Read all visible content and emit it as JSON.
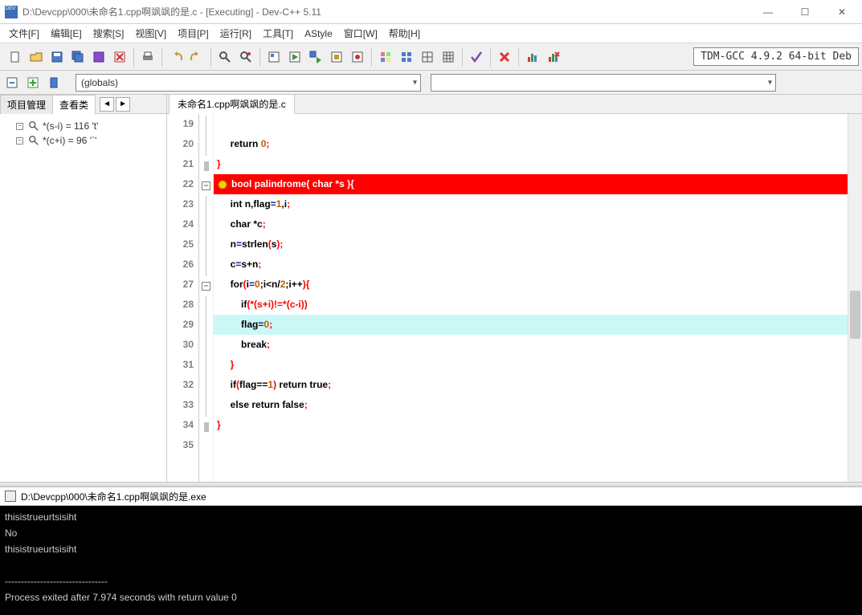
{
  "window": {
    "title": "D:\\Devcpp\\000\\未命名1.cpp啊飒飒的是.c - [Executing] - Dev-C++ 5.11",
    "min": "—",
    "max": "☐",
    "close": "✕"
  },
  "menu": {
    "items": [
      "文件[F]",
      "编辑[E]",
      "搜索[S]",
      "视图[V]",
      "项目[P]",
      "运行[R]",
      "工具[T]",
      "AStyle",
      "窗口[W]",
      "帮助[H]"
    ]
  },
  "compiler_label": "TDM-GCC 4.9.2 64-bit Deb",
  "globals_combo": "(globals)",
  "sidebar": {
    "tabs": [
      "项目管理",
      "查看类"
    ],
    "nav_left": "◄",
    "nav_right": "►",
    "items": [
      {
        "label": "*(s-i) = 116 't'"
      },
      {
        "label": "*(c+i) = 96 '`'"
      }
    ]
  },
  "editor": {
    "tab_label": "未命名1.cpp啊飒飒的是.c",
    "line_numbers": [
      "19",
      "20",
      "21",
      "22",
      "23",
      "24",
      "25",
      "26",
      "27",
      "28",
      "29",
      "30",
      "31",
      "32",
      "33",
      "34",
      "35"
    ],
    "lines": {
      "l20_return": "return",
      "l20_zero": "0",
      "l22_bool": "bool",
      "l22_name": "palindrome",
      "l22_char": "char",
      "l22_arg": "*s",
      "l23_int": "int",
      "l23_vars": "n,flag",
      "l23_one": "1",
      "l23_i": ",i",
      "l24_char": "char",
      "l24_c": "*c",
      "l25_assign": "n",
      "l25_eq": "=",
      "l25_fn": "strlen",
      "l25_arg": "s",
      "l26_lhs": "c",
      "l26_eq": "=",
      "l26_rhs": "s+n",
      "l27_for": "for",
      "l27_init": "i",
      "l27_eq": "=",
      "l27_z": "0",
      "l27_cond": ";i<n/",
      "l27_two": "2",
      "l27_upd": ";i++",
      "l28_if": "if",
      "l28_expr": "(*(s+i)!=*(c-i))",
      "l29_lhs": "flag",
      "l29_eq": "=",
      "l29_z": "0",
      "l30_break": "break",
      "l32_if": "if",
      "l32_cond": "flag==",
      "l32_one": "1",
      "l32_ret": "return",
      "l32_true": "true",
      "l33_else": "else",
      "l33_ret": "return",
      "l33_false": "false"
    }
  },
  "console": {
    "title": "D:\\Devcpp\\000\\未命名1.cpp啊飒飒的是.exe",
    "lines": [
      "thisistrueurtsisiht",
      "No",
      "thisistrueurtsisiht",
      "",
      "--------------------------------",
      "Process exited after 7.974 seconds with return value 0"
    ]
  }
}
